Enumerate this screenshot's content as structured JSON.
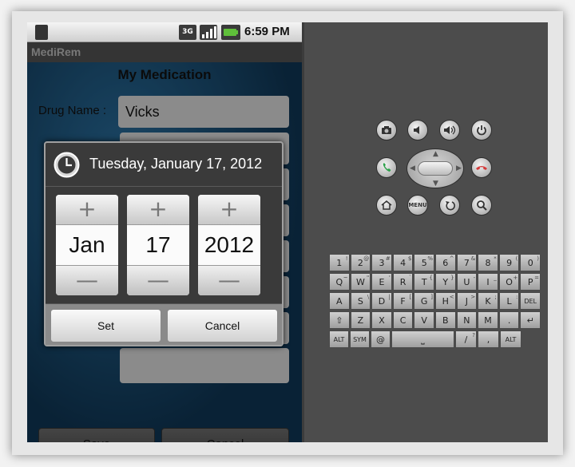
{
  "status_bar": {
    "network": "3G",
    "time": "6:59 PM"
  },
  "app": {
    "title": "MediRem",
    "heading": "My Medication",
    "drug_label": "Drug Name :",
    "drug_value": "Vicks"
  },
  "buttons": {
    "save": "Save",
    "cancel": "Cancel"
  },
  "dialog": {
    "title": "Tuesday, January 17, 2012",
    "month": "Jan",
    "day": "17",
    "year": "2012",
    "plus": "+",
    "minus": "—",
    "set": "Set",
    "cancel": "Cancel"
  },
  "controls": {
    "icons": [
      "camera-icon",
      "volume-down-icon",
      "volume-up-icon",
      "power-icon",
      "call-icon",
      "end-call-icon",
      "home-icon",
      "menu-icon",
      "back-icon",
      "search-icon"
    ],
    "menu_label": "MENU"
  },
  "keyboard": {
    "row1": [
      [
        "1",
        "!"
      ],
      [
        "2",
        "@"
      ],
      [
        "3",
        "#"
      ],
      [
        "4",
        "$"
      ],
      [
        "5",
        "%"
      ],
      [
        "6",
        "^"
      ],
      [
        "7",
        "&"
      ],
      [
        "8",
        "*"
      ],
      [
        "9",
        "("
      ],
      [
        "0",
        ")"
      ]
    ],
    "row2": [
      [
        "Q",
        "~"
      ],
      [
        "W",
        "\""
      ],
      [
        "E",
        "'"
      ],
      [
        "R",
        "`"
      ],
      [
        "T",
        "{"
      ],
      [
        "Y",
        "}"
      ],
      [
        "U",
        "-"
      ],
      [
        "I",
        "_"
      ],
      [
        "O",
        "+"
      ],
      [
        "P",
        "="
      ]
    ],
    "row3": [
      [
        "A",
        ""
      ],
      [
        "S",
        "\\"
      ],
      [
        "D",
        "|"
      ],
      [
        "F",
        "["
      ],
      [
        "G",
        "]"
      ],
      [
        "H",
        "<"
      ],
      [
        "J",
        ">"
      ],
      [
        "K",
        ";"
      ],
      [
        "L",
        ":"
      ],
      [
        "DEL",
        ""
      ]
    ],
    "row4": [
      [
        "⇧",
        ""
      ],
      [
        "Z",
        ""
      ],
      [
        "X",
        ""
      ],
      [
        "C",
        ""
      ],
      [
        "V",
        ""
      ],
      [
        "B",
        ""
      ],
      [
        "N",
        ""
      ],
      [
        "M",
        ""
      ],
      [
        ".",
        ""
      ],
      [
        "↵",
        ""
      ]
    ],
    "row5": [
      [
        "ALT",
        ""
      ],
      [
        "SYM",
        ""
      ],
      [
        "@",
        ""
      ],
      [
        "⎵",
        ""
      ],
      [
        "/",
        "?"
      ],
      [
        ",",
        ""
      ],
      [
        "ALT",
        ""
      ]
    ]
  },
  "colors": {
    "app_bg": "#1f5a85",
    "dialog_bg": "#3a3a3a",
    "accept": "#2da14a",
    "reject": "#d43a3a"
  }
}
